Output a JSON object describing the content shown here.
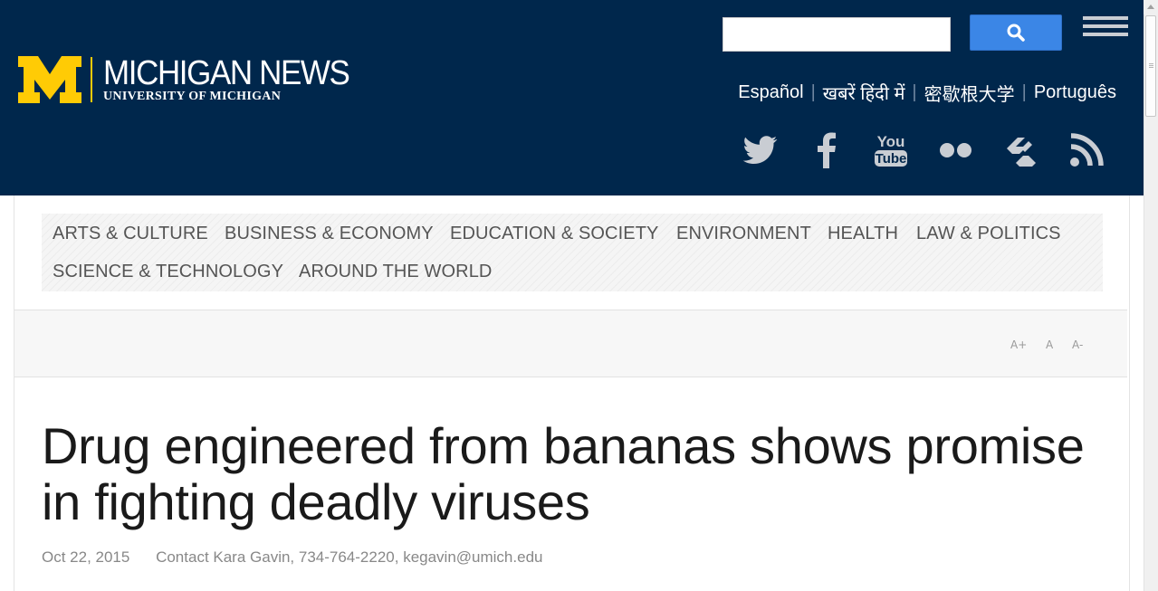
{
  "brand": {
    "title": "MICHIGAN NEWS",
    "subtitle": "UNIVERSITY OF MICHIGAN",
    "maize": "#ffcb05",
    "blue": "#00274c"
  },
  "search": {
    "value": "",
    "placeholder": "",
    "button_icon": "search-icon",
    "button_color": "#3b86e6"
  },
  "menu_icon": "hamburger-icon",
  "languages": [
    "Español",
    "खबरें हिंदी में",
    "密歇根大学",
    "Português"
  ],
  "social": [
    "twitter-icon",
    "facebook-icon",
    "youtube-icon",
    "flickr-icon",
    "storify-icon",
    "rss-icon"
  ],
  "topics": [
    "ARTS & CULTURE",
    "BUSINESS & ECONOMY",
    "EDUCATION & SOCIETY",
    "ENVIRONMENT",
    "HEALTH",
    "LAW & POLITICS",
    "SCIENCE & TECHNOLOGY",
    "AROUND THE WORLD"
  ],
  "font_controls": {
    "increase": "A+",
    "normal": "A",
    "decrease": "A-"
  },
  "article": {
    "headline": "Drug engineered from bananas shows promise in fighting deadly viruses",
    "date": "Oct 22, 2015",
    "contact": "Contact Kara Gavin, 734-764-2220, kegavin@umich.edu"
  }
}
